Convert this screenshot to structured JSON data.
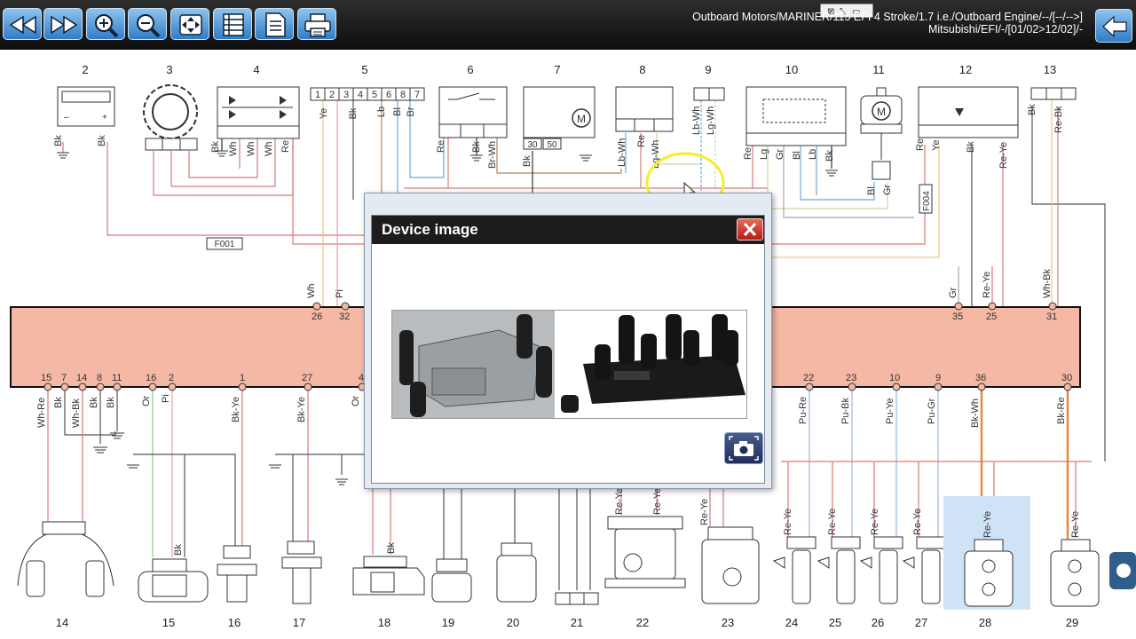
{
  "toolbar": {
    "buttons": [
      {
        "name": "rewind-button",
        "icon": "rewind-icon"
      },
      {
        "name": "fast-forward-button",
        "icon": "fast-forward-icon"
      },
      {
        "name": "zoom-in-button",
        "icon": "zoom-in-icon"
      },
      {
        "name": "zoom-out-button",
        "icon": "zoom-out-icon"
      },
      {
        "name": "fit-page-button",
        "icon": "fit-page-icon"
      },
      {
        "name": "list-button",
        "icon": "list-icon"
      },
      {
        "name": "document-button",
        "icon": "document-icon"
      },
      {
        "name": "print-button",
        "icon": "printer-icon"
      }
    ],
    "breadcrumb_line1": "Outboard Motors/MARINER/115 EFI 4 Stroke/1.7 i.e./Outboard Engine/--/[--/-->]",
    "breadcrumb_line2": "Mitsubishi/EFI/-/[01/02>12/02]/-",
    "back_icon": "back-arrow-icon"
  },
  "diagram": {
    "top_component_numbers": [
      "2",
      "3",
      "4",
      "5",
      "6",
      "7",
      "8",
      "9",
      "10",
      "11",
      "12",
      "13"
    ],
    "bottom_component_numbers": [
      "14",
      "15",
      "16",
      "17",
      "18",
      "19",
      "20",
      "21",
      "22",
      "23",
      "24",
      "25",
      "26",
      "27",
      "28",
      "29"
    ],
    "top_pins": [
      {
        "label": "Wh",
        "pin": "26"
      },
      {
        "label": "Pi",
        "pin": "32"
      },
      {
        "label": "Gr",
        "pin": "35"
      },
      {
        "label": "Re-Ye",
        "pin": "25"
      },
      {
        "label": "Wh-Bk",
        "pin": "31"
      }
    ],
    "bottom_pins": [
      {
        "label": "Wh-Re",
        "pin": "15"
      },
      {
        "label": "Bk",
        "pin": "7"
      },
      {
        "label": "Wh-Bk",
        "pin": "14"
      },
      {
        "label": "Bk",
        "pin": "8"
      },
      {
        "label": "Bk",
        "pin": "11"
      },
      {
        "label": "Or",
        "pin": "16"
      },
      {
        "label": "Pi",
        "pin": "2"
      },
      {
        "label": "Bk-Ye",
        "pin": "1"
      },
      {
        "label": "Bk-Ye",
        "pin": "27"
      },
      {
        "label": "Or",
        "pin": "4"
      },
      {
        "label": "Pu-Re",
        "pin": "22"
      },
      {
        "label": "Pu-Bk",
        "pin": "23"
      },
      {
        "label": "Pu-Ye",
        "pin": "10"
      },
      {
        "label": "Pu-Gr",
        "pin": "9"
      },
      {
        "label": "Bk-Wh",
        "pin": "36"
      },
      {
        "label": "Bk-Re",
        "pin": "30"
      }
    ],
    "connector_5_pins": [
      "1",
      "2",
      "3",
      "4",
      "5",
      "6",
      "8",
      "7"
    ],
    "connector_7_pins": [
      "30",
      "50"
    ],
    "fuse_f001": "F001",
    "fuse_f004": "F004",
    "wire_labels_top": {
      "c2": [
        "Bk",
        "Bk"
      ],
      "c4": [
        "Bk",
        "Wh",
        "Wh",
        "Wh",
        "Re"
      ],
      "c5": [
        "Ye",
        "Bk",
        "Lb",
        "Bl",
        "Br"
      ],
      "c6": [
        "Re",
        "Bk",
        "Br-Wh"
      ],
      "c7": [
        "Bk"
      ],
      "c8": [
        "Lb-Wh",
        "Re",
        "Lg-Wh"
      ],
      "c9": [
        "Lb-Wh",
        "Lg-Wh"
      ],
      "c10": [
        "Re",
        "Lg",
        "Gr",
        "Bl",
        "Lb",
        "Bk"
      ],
      "c11": [
        "Bl",
        "Gr"
      ],
      "c12": [
        "Re",
        "Ye",
        "Bk",
        "Re-Ye"
      ],
      "c13": [
        "Bk",
        "Re-Bk"
      ]
    },
    "wire_labels_bottom": {
      "c15": "Bk",
      "c18": "Bk",
      "c22": [
        "Re-Ye",
        "Re-Ye"
      ],
      "c23": "Re-Ye",
      "c24": "Re-Ye",
      "c25": "Re-Ye",
      "c26": "Re-Ye",
      "c27": "Re-Ye",
      "c28": "Re-Ye",
      "c29": "Re-Ye"
    },
    "ecu_color": "#f4b8a4",
    "motor_symbol": "M"
  },
  "dialog": {
    "title": "Device image",
    "close_icon": "close-icon",
    "camera_icon": "camera-icon",
    "photo_alt": "ignition-coil-photo"
  },
  "colors": {
    "toolbar_bg": "#1a1a1a",
    "button_blue": "#4c97da",
    "dialog_title_bg": "#1c1c1c",
    "close_red": "#d43a2c",
    "highlight_yellow": "#f3ee2a",
    "selection_blue": "#cfe3f7"
  }
}
